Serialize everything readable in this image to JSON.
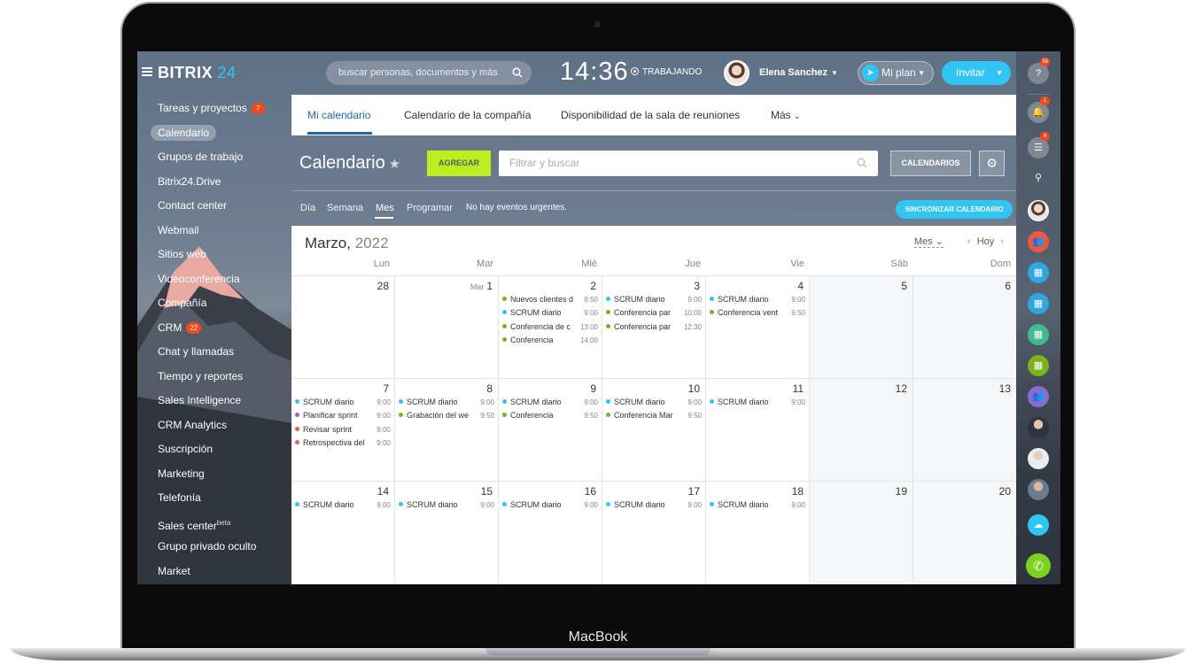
{
  "device": {
    "label": "MacBook"
  },
  "app": {
    "logo_text": "BITRIX",
    "logo_number": "24",
    "search_placeholder": "buscar personas, documentos y más",
    "clock": "14:36",
    "work_status": "TRABAJANDO",
    "user_name": "Elena Sanchez",
    "plan_label": "Mi plan",
    "invite_label": "Invitar"
  },
  "sidebar": {
    "items": [
      {
        "label": "Tareas y proyectos",
        "badge": "7"
      },
      {
        "label": "Calendario",
        "active": true
      },
      {
        "label": "Grupos de trabajo"
      },
      {
        "label": "Bitrix24.Drive"
      },
      {
        "label": "Contact center"
      },
      {
        "label": "Webmail"
      },
      {
        "label": "Sitios web"
      },
      {
        "label": "Videoconferencia"
      },
      {
        "label": "Compañía"
      },
      {
        "label": "CRM",
        "badge": "22"
      },
      {
        "label": "Chat y llamadas"
      },
      {
        "label": "Tiempo y reportes"
      },
      {
        "label": "Sales Intelligence"
      },
      {
        "label": "CRM Analytics"
      },
      {
        "label": "Suscripción"
      },
      {
        "label": "Marketing"
      },
      {
        "label": "Telefonía"
      },
      {
        "label": "Sales center",
        "sup": "beta"
      },
      {
        "label": "Grupo privado oculto"
      },
      {
        "label": "Market"
      }
    ]
  },
  "rail": {
    "help_count": "39",
    "notifications_count": "1",
    "chat_count": "4"
  },
  "tabs": [
    "Mi calendario",
    "Calendario de la compañía",
    "Disponibilidad de la sala de reuniones",
    "Más"
  ],
  "toolbar": {
    "title": "Calendario",
    "add_label": "AGREGAR",
    "filter_placeholder": "Filtrar y buscar",
    "calendars_label": "CALENDARIOS"
  },
  "views": {
    "items": [
      "Día",
      "Semana",
      "Mes",
      "Programar"
    ],
    "active": "Mes",
    "no_events": "No hay eventos urgentes.",
    "sync_label": "SINCRONIZAR CALENDARIO"
  },
  "calendar": {
    "month": "Marzo,",
    "year": "2022",
    "view_select": "Mes",
    "today_label": "Hoy",
    "weekdays": [
      "Lun",
      "Mar",
      "Mié",
      "Jue",
      "Vie",
      "Sáb",
      "Dom"
    ],
    "colors": {
      "blue": "#2fc6f6",
      "green": "#7bb31a",
      "purple": "#a861c3",
      "red": "#e95c5c"
    },
    "weeks": [
      [
        {
          "day": "28",
          "events": []
        },
        {
          "day": "1",
          "prefix": "Mar",
          "events": []
        },
        {
          "day": "2",
          "events": [
            {
              "name": "Nuevos clientes d",
              "time": "8:50",
              "color": "green"
            },
            {
              "name": "SCRUM diario",
              "time": "9:00",
              "color": "blue"
            },
            {
              "name": "Conferencia de c",
              "time": "13:00",
              "color": "green"
            },
            {
              "name": "Conferencia",
              "time": "14:00",
              "color": "green"
            }
          ]
        },
        {
          "day": "3",
          "events": [
            {
              "name": "SCRUM diario",
              "time": "9:00",
              "color": "blue"
            },
            {
              "name": "Conferencia par",
              "time": "10:00",
              "color": "green"
            },
            {
              "name": "Conferencia par",
              "time": "12:30",
              "color": "green"
            }
          ]
        },
        {
          "day": "4",
          "events": [
            {
              "name": "SCRUM diario",
              "time": "9:00",
              "color": "blue"
            },
            {
              "name": "Conferencia vent",
              "time": "9:50",
              "color": "green"
            }
          ]
        },
        {
          "day": "5",
          "weekend": true,
          "events": []
        },
        {
          "day": "6",
          "weekend": true,
          "events": []
        }
      ],
      [
        {
          "day": "7",
          "events": [
            {
              "name": "SCRUM diario",
              "time": "9:00",
              "color": "blue"
            },
            {
              "name": "Planificar sprint",
              "time": "9:00",
              "color": "purple"
            },
            {
              "name": "Revisar sprint",
              "time": "9:00",
              "color": "red"
            },
            {
              "name": "Retrospectiva del",
              "time": "9:00",
              "color": "red"
            }
          ]
        },
        {
          "day": "8",
          "events": [
            {
              "name": "SCRUM diario",
              "time": "9:00",
              "color": "blue"
            },
            {
              "name": "Grabación del we",
              "time": "9:50",
              "color": "green"
            }
          ]
        },
        {
          "day": "9",
          "events": [
            {
              "name": "SCRUM diario",
              "time": "9:00",
              "color": "blue"
            },
            {
              "name": "Conferencia",
              "time": "9:50",
              "color": "green"
            }
          ]
        },
        {
          "day": "10",
          "events": [
            {
              "name": "SCRUM diario",
              "time": "9:00",
              "color": "blue"
            },
            {
              "name": "Conferencia Mar",
              "time": "9:50",
              "color": "green"
            }
          ]
        },
        {
          "day": "11",
          "events": [
            {
              "name": "SCRUM diario",
              "time": "9:00",
              "color": "blue"
            }
          ]
        },
        {
          "day": "12",
          "weekend": true,
          "events": []
        },
        {
          "day": "13",
          "weekend": true,
          "events": []
        }
      ],
      [
        {
          "day": "14",
          "events": [
            {
              "name": "SCRUM diario",
              "time": "9:00",
              "color": "blue"
            }
          ]
        },
        {
          "day": "15",
          "events": [
            {
              "name": "SCRUM diario",
              "time": "9:00",
              "color": "blue"
            }
          ]
        },
        {
          "day": "16",
          "events": [
            {
              "name": "SCRUM diario",
              "time": "9:00",
              "color": "blue"
            }
          ]
        },
        {
          "day": "17",
          "events": [
            {
              "name": "SCRUM diario",
              "time": "9:00",
              "color": "blue"
            }
          ]
        },
        {
          "day": "18",
          "events": [
            {
              "name": "SCRUM diario",
              "time": "9:00",
              "color": "blue"
            }
          ]
        },
        {
          "day": "19",
          "weekend": true,
          "events": []
        },
        {
          "day": "20",
          "weekend": true,
          "events": []
        }
      ]
    ]
  }
}
